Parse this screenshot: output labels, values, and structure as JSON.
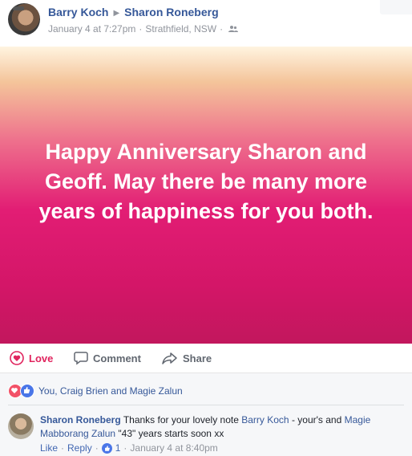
{
  "post": {
    "author": "Barry Koch",
    "recipient": "Sharon Roneberg",
    "date": "January 4 at 7:27pm",
    "location": "Strathfield, NSW",
    "audience_icon": "friends-icon",
    "text": "Happy Anniversary Sharon and Geoff. May there be many more years of happiness for you both."
  },
  "actions": {
    "love": "Love",
    "comment": "Comment",
    "share": "Share"
  },
  "reactions": {
    "summary": "You, Craig Brien and Magie Zalun"
  },
  "comment": {
    "author": "Sharon Roneberg",
    "text_1": "Thanks for your lovely note",
    "mention_1": "Barry Koch",
    "text_2": "- your's and",
    "mention_2": "Magie Mabborang Zalun",
    "text_3": "\"43\" years starts soon xx",
    "like": "Like",
    "reply": "Reply",
    "like_count": "1",
    "time": "January 4 at 8:40pm"
  },
  "colors": {
    "link": "#365899",
    "love": "#e0245e",
    "like": "#4a76e8",
    "gradient_top": "#fff4e0",
    "gradient_mid": "#e21d74",
    "gradient_bottom": "#c2175d"
  }
}
